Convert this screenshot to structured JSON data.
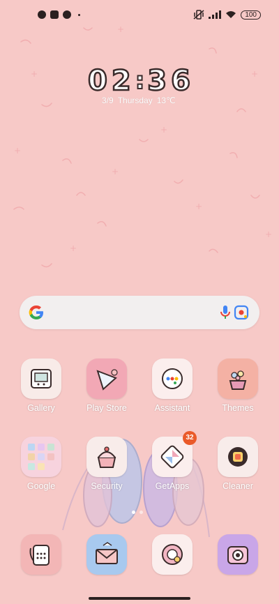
{
  "status": {
    "battery": "100"
  },
  "clock": {
    "digits": [
      "0",
      "2",
      "3",
      "6"
    ]
  },
  "date": {
    "day": "3/9",
    "weekday": "Thursday",
    "temp": "13℃"
  },
  "search": {
    "icons": [
      "google-g-icon",
      "mic-icon",
      "lens-icon"
    ]
  },
  "apps": [
    {
      "label": "Gallery",
      "icon": "gallery-icon",
      "color": "#f8ebe8"
    },
    {
      "label": "Play Store",
      "icon": "play-store-icon",
      "color": "#f2a8b5"
    },
    {
      "label": "Assistant",
      "icon": "assistant-icon",
      "color": "#fbeeed"
    },
    {
      "label": "Themes",
      "icon": "themes-icon",
      "color": "#f4b1a4"
    },
    {
      "label": "Google",
      "icon": "google-folder-icon",
      "color": "#f7d3de"
    },
    {
      "label": "Security",
      "icon": "security-icon",
      "color": "#f8ecea"
    },
    {
      "label": "GetApps",
      "icon": "getapps-icon",
      "color": "#fbeeed",
      "badge": "32"
    },
    {
      "label": "Cleaner",
      "icon": "cleaner-icon",
      "color": "#f8ecea"
    }
  ],
  "dock": [
    {
      "icon": "phone-icon",
      "color": "#f3b6b6"
    },
    {
      "icon": "messages-icon",
      "color": "#a8c9ef"
    },
    {
      "icon": "browser-icon",
      "color": "#fbeeed"
    },
    {
      "icon": "camera-icon",
      "color": "#c9a6e8"
    }
  ]
}
